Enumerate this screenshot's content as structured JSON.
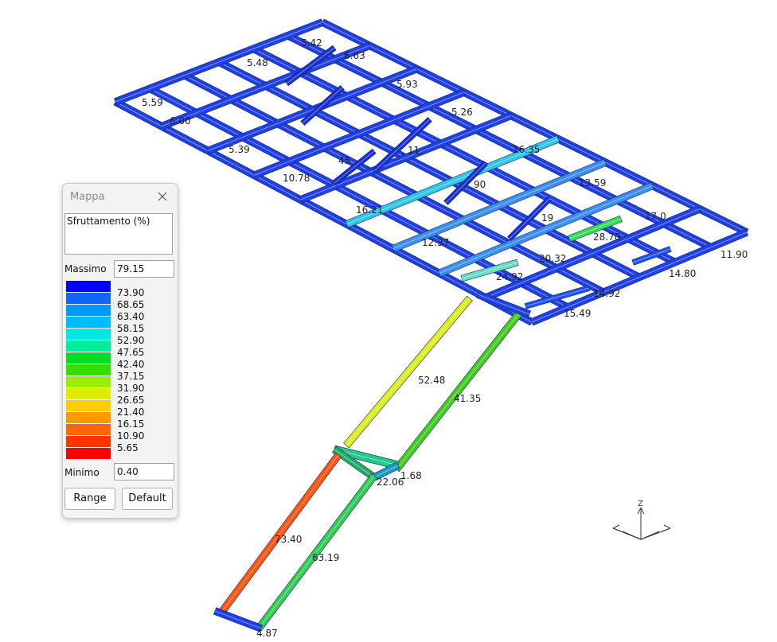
{
  "window": {
    "title": "Mappa"
  },
  "legend": {
    "description": "Sfruttamento (%)",
    "max_label": "Massimo",
    "max_value": "79.15",
    "min_label": "Minimo",
    "min_value": "0.40",
    "range_button": "Range",
    "default_button": "Default",
    "ticks": [
      "73.90",
      "68.65",
      "63.40",
      "58.15",
      "52.90",
      "47.65",
      "42.40",
      "37.15",
      "31.90",
      "26.65",
      "21.40",
      "16.15",
      "10.90",
      "5.65"
    ],
    "colors": [
      "#ff0000",
      "#ff3300",
      "#ff6600",
      "#ff9900",
      "#ffcc00",
      "#ddee00",
      "#99ee00",
      "#33dd00",
      "#00dd22",
      "#00ee99",
      "#00e8e0",
      "#00bbff",
      "#0099ff",
      "#1166ff",
      "#0000ff"
    ]
  },
  "structure": {
    "member_labels": [
      "52.48",
      "41.35",
      "73.40",
      "63.19",
      "22.06",
      "1.68",
      "4.87",
      "24.92",
      "14.92",
      "15.49",
      "16.35",
      "13.59",
      "11.90",
      "14.80",
      "20.32",
      "28.70",
      "12.37",
      "16.21",
      "10.78",
      "6.00",
      "5.59",
      "5.48",
      "5.42",
      "6.63",
      "5.93",
      "5.26",
      "5.39",
      "45",
      "11",
      "90",
      "19",
      "17.0"
    ]
  },
  "axes": {
    "z_label": "Z"
  }
}
